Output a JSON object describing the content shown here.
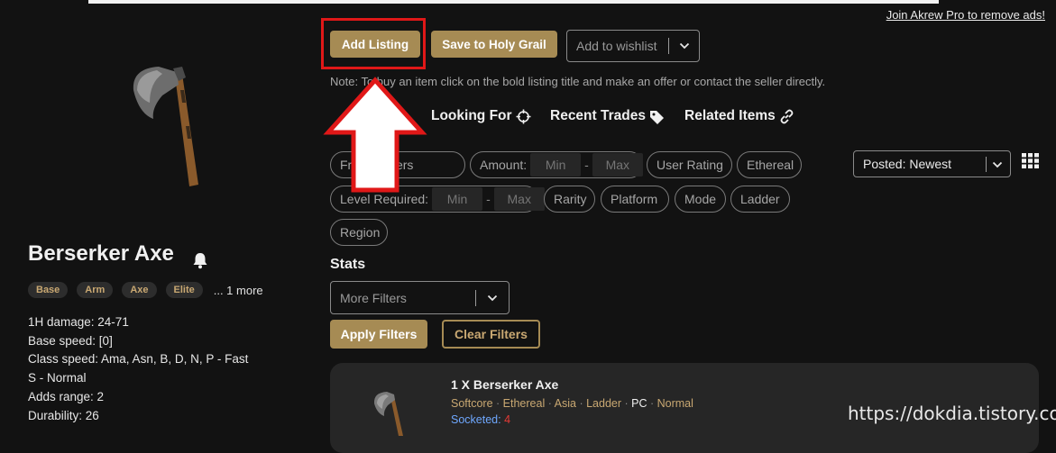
{
  "promo_link": "Join Akrew Pro to remove ads!",
  "item": {
    "name": "Berserker Axe",
    "tags": [
      "Base",
      "Arm",
      "Axe",
      "Elite"
    ],
    "more_tags": "... 1 more",
    "stats": [
      "1H damage: 24-71",
      "Base speed: [0]",
      "Class speed: Ama, Asn, B, D, N, P - Fast",
      "S - Normal",
      "Adds range: 2",
      "Durability: 26"
    ]
  },
  "actions": {
    "add_listing": "Add Listing",
    "save_holy_grail": "Save to Holy Grail",
    "wishlist_placeholder": "Add to wishlist"
  },
  "note": "Note: To buy an item click on the bold listing title and make an offer or contact the seller directly.",
  "tabs": [
    "Looking For",
    "Recent Trades",
    "Related Items"
  ],
  "filters": {
    "free_make_offers": "Fr    ake Offers",
    "amount": "Amount:",
    "min": "Min",
    "max": "Max",
    "user_rating": "User Rating",
    "ethereal": "Ethereal",
    "level_required": "Level Required:",
    "rarity": "Rarity",
    "platform": "Platform",
    "mode": "Mode",
    "ladder": "Ladder",
    "region": "Region"
  },
  "sort": {
    "selected": "Posted: Newest"
  },
  "stats_section": {
    "heading": "Stats",
    "more_filters": "More Filters",
    "apply": "Apply Filters",
    "clear": "Clear Filters"
  },
  "listing": {
    "title": "1 X Berserker Axe",
    "meta": [
      "Softcore",
      "Ethereal",
      "Asia",
      "Ladder",
      "PC",
      "Normal"
    ],
    "socketed_label": "Socketed:",
    "socketed_value": "4"
  },
  "watermark": "https://dokdia.tistory.com",
  "colors": {
    "gold": "#a68b54",
    "highlight": "#e01818",
    "background": "#121212",
    "card": "#262626"
  }
}
